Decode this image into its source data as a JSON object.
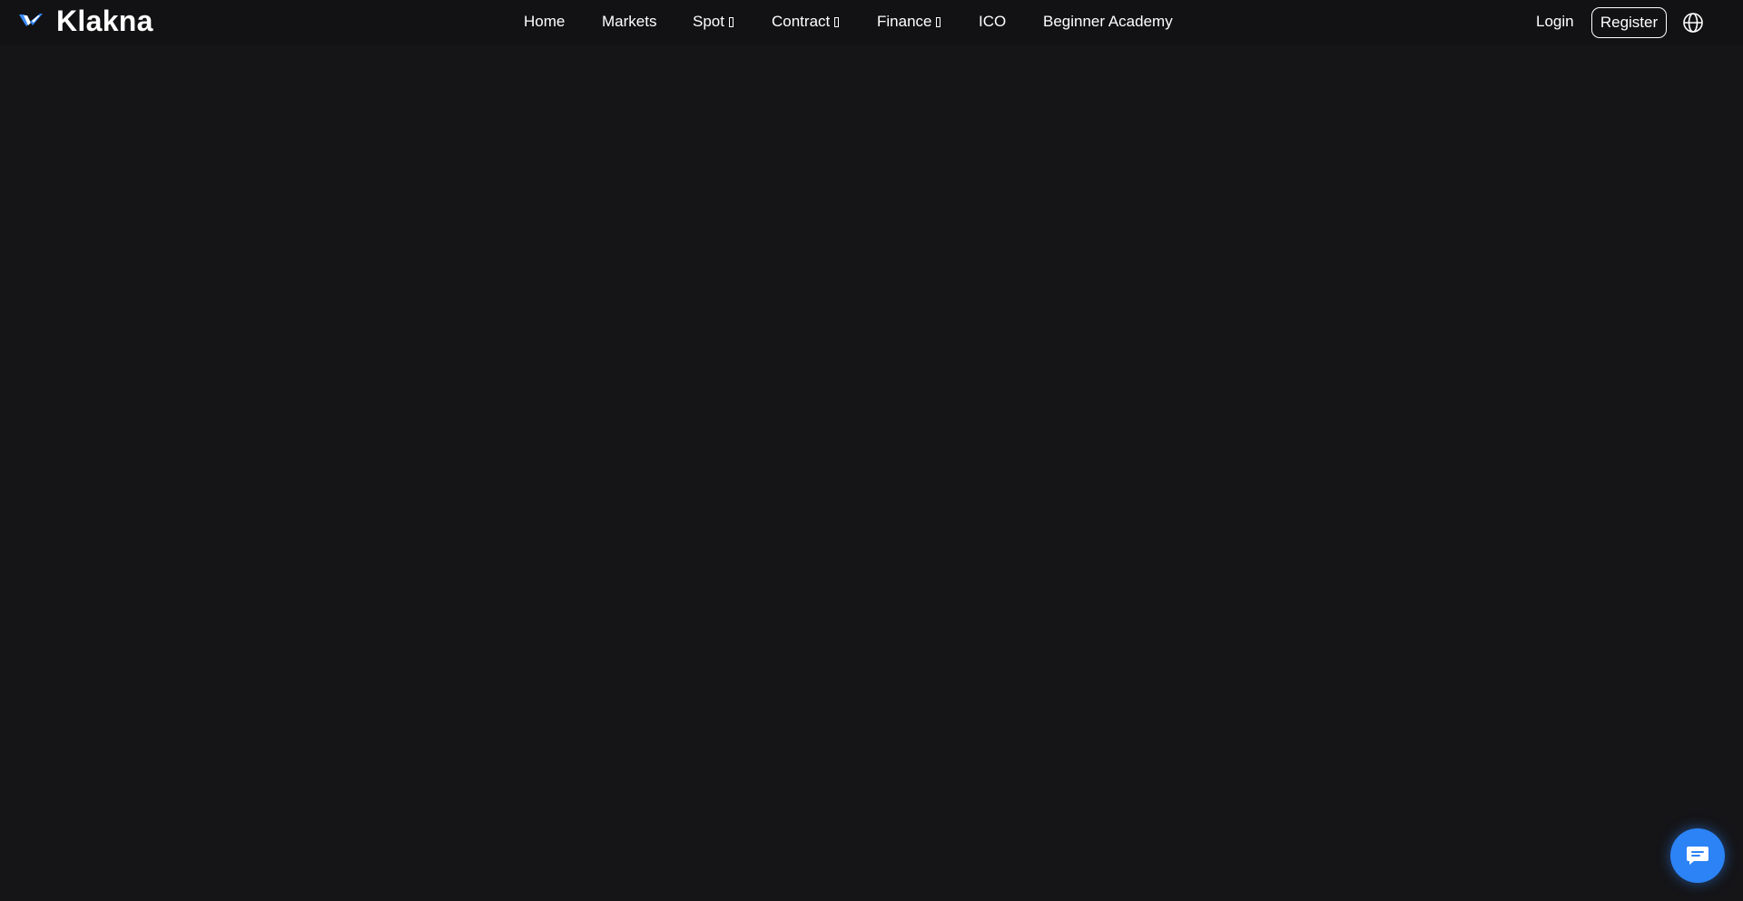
{
  "brand": {
    "name": "Klakna",
    "accent": "#2c83f6"
  },
  "nav": {
    "items": [
      {
        "label": "Home",
        "has_dropdown": false
      },
      {
        "label": "Markets",
        "has_dropdown": false
      },
      {
        "label": "Spot",
        "has_dropdown": true
      },
      {
        "label": "Contract",
        "has_dropdown": true
      },
      {
        "label": "Finance",
        "has_dropdown": true
      },
      {
        "label": "ICO",
        "has_dropdown": false
      },
      {
        "label": "Beginner Academy",
        "has_dropdown": false
      }
    ]
  },
  "auth": {
    "login_label": "Login",
    "register_label": "Register"
  },
  "icons": {
    "language": "globe-icon",
    "chat": "chat-bubble-icon",
    "logo": "brand-logo-icon",
    "dropdown": "chevron-down-icon"
  },
  "colors": {
    "background": "#151518",
    "topbar": "#121214",
    "text": "#ffffff",
    "chat_button": "#2c83f6"
  }
}
